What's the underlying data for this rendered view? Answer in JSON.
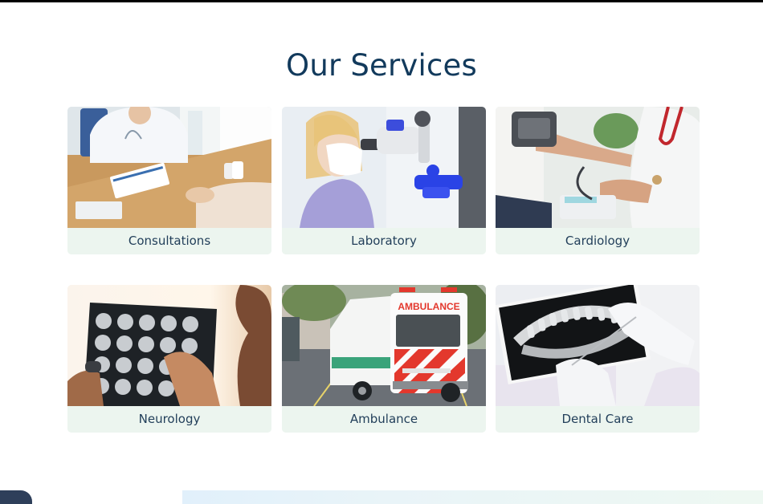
{
  "section": {
    "title": "Our Services"
  },
  "services": [
    {
      "label": "Consultations",
      "icon": "doctor-consultation-photo"
    },
    {
      "label": "Laboratory",
      "icon": "lab-microscope-photo"
    },
    {
      "label": "Cardiology",
      "icon": "blood-pressure-photo"
    },
    {
      "label": "Neurology",
      "icon": "brain-scan-photo"
    },
    {
      "label": "Ambulance",
      "icon": "ambulance-photo",
      "vehicle_text": "AMBULANCE"
    },
    {
      "label": "Dental Care",
      "icon": "dental-xray-photo"
    }
  ],
  "colors": {
    "title": "#123a5c",
    "label_text": "#223f5a",
    "label_background": "#ecf5ef"
  }
}
